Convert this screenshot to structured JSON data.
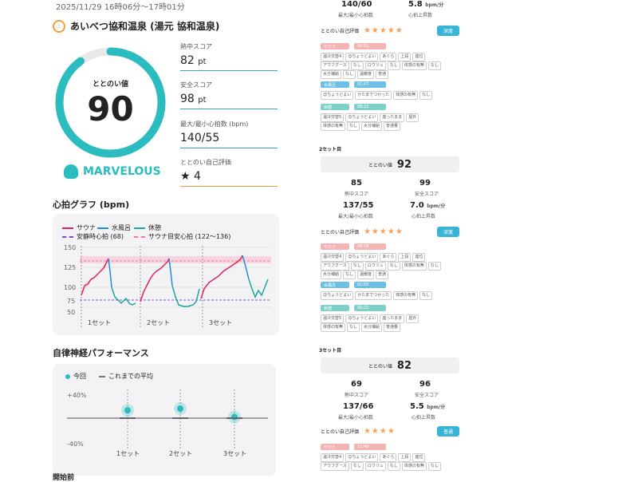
{
  "header": {
    "datetime": "2025/11/29 16時06分〜17時01分",
    "facility": "あいべつ協和温泉 (湯元 協和温泉)"
  },
  "gauge": {
    "label": "ととのい値",
    "value": "90",
    "fraction": 0.9,
    "color": "#2bbcc0"
  },
  "rank": "MARVELOUS",
  "stats": [
    {
      "label": "熱中スコア",
      "value": "82",
      "unit": "pt"
    },
    {
      "label": "安全スコア",
      "value": "98",
      "unit": "pt"
    },
    {
      "label": "最大/最小心拍数 (bpm)",
      "value": "140/55",
      "unit": ""
    },
    {
      "label": "ととのい自己評価",
      "value": "★ 4",
      "unit": ""
    }
  ],
  "heart_graph": {
    "title": "心拍グラフ (bpm)",
    "legend": [
      "サウナ",
      "水風呂",
      "休憩",
      "安静時心拍 (68)",
      "サウナ目安心拍 (122〜136)"
    ],
    "y_ticks": [
      "150",
      "125",
      "100",
      "75",
      "50"
    ],
    "x_labels": [
      "1セット",
      "2セット",
      "3セット"
    ],
    "colors": {
      "sauna": "#e0245e",
      "water": "#1f8fd6",
      "rest": "#1aa79b",
      "resting": "#7b4fd1",
      "target": "#f07a9b"
    }
  },
  "autonomic": {
    "title": "自律神経パフォーマンス",
    "legend_now": "今回",
    "legend_avg": "これまでの平均",
    "y_top": "+40%",
    "y_bottom": "-40%",
    "x_labels": [
      "1セット",
      "2セット",
      "3セット"
    ],
    "values": [
      13,
      16,
      2
    ]
  },
  "next_section": "開始前",
  "right": {
    "top_hr": "140/60",
    "top_hr_label": "最大/最小心拍数",
    "top_rate": "5.8",
    "top_rate_unit": "bpm/分",
    "top_rate_label": "心拍上昇数",
    "set1": {
      "eval_label": "ととのい自己評価",
      "stars": "★★★★★",
      "badge": "深度",
      "sauna": "サウナ",
      "sauna_time": "06:01",
      "water": "水風呂",
      "water_time": "01:07",
      "rest": "休憩",
      "rest_time": "08:22",
      "tags1": [
        "温冷交替4",
        "😊ちょうどよい",
        "あぐら",
        "上段",
        "座位"
      ],
      "tags2": [
        "アウフグース",
        "なし",
        "ロウリュ",
        "なし",
        "体感の有無",
        "なし"
      ],
      "tags3": [
        "水分補給",
        "なし",
        "温暖度",
        "普通"
      ],
      "tags4": [
        "😊ちょうどよい",
        "かたまでつかった",
        "体感の有無",
        "なし"
      ],
      "tags5": [
        "温冷交替5",
        "😊ちょうどよい",
        "座ったまま",
        "屋外"
      ],
      "tags6": [
        "体感の有無",
        "なし",
        "水分補給",
        "普通量"
      ]
    },
    "set2": {
      "title": "2セット目",
      "score_label": "ととのい値",
      "score": "92",
      "heat": "85",
      "heat_label": "熱中スコア",
      "safe": "99",
      "safe_label": "安全スコア",
      "hr": "137/55",
      "hr_label": "最大/最小心拍数",
      "rate": "7.0",
      "rate_unit": "bpm/分",
      "rate_label": "心拍上昇数",
      "eval_label": "ととのい自己評価",
      "stars": "★★★★★",
      "badge": "深度",
      "sauna": "サウナ",
      "sauna_time": "08:09",
      "water": "水風呂",
      "water_time": "01:05",
      "rest": "休憩",
      "rest_time": "06:21"
    },
    "set3": {
      "title": "3セット目",
      "score_label": "ととのい値",
      "score": "82",
      "heat": "69",
      "heat_label": "熱中スコア",
      "safe": "96",
      "safe_label": "安全スコア",
      "hr": "137/66",
      "hr_label": "最大/最小心拍数",
      "rate": "5.5",
      "rate_unit": "bpm/分",
      "rate_label": "心拍上昇数",
      "eval_label": "ととのい自己評価",
      "stars": "★★★★",
      "badge": "普通",
      "sauna": "サウナ",
      "sauna_time": "11:49"
    }
  }
}
